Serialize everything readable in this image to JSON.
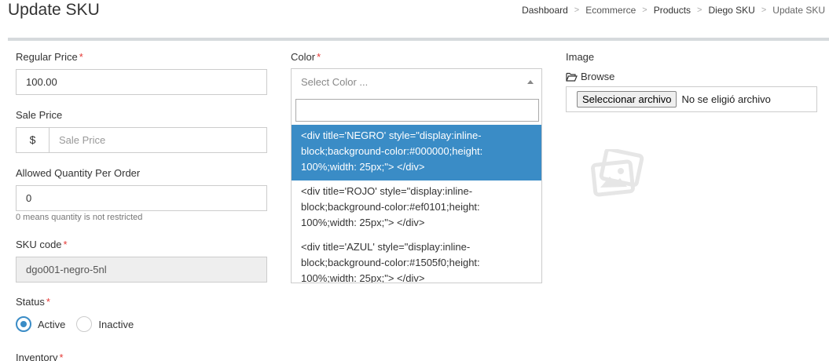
{
  "header": {
    "title": "Update SKU"
  },
  "breadcrumb": [
    "Dashboard",
    "Ecommerce",
    "Products",
    "Diego SKU",
    "Update SKU"
  ],
  "form": {
    "regular_price": {
      "label": "Regular Price",
      "required": "*",
      "value": "100.00"
    },
    "sale_price": {
      "label": "Sale Price",
      "addon": "$",
      "placeholder": "Sale Price"
    },
    "allowed_qty": {
      "label": "Allowed Quantity Per Order",
      "value": "0",
      "help": "0 means quantity is not restricted"
    },
    "sku_code": {
      "label": "SKU code",
      "required": "*",
      "value": "dgo001-negro-5nl"
    },
    "status": {
      "label": "Status",
      "required": "*",
      "options": [
        "Active",
        "Inactive"
      ],
      "selected": "Active"
    },
    "inventory": {
      "label": "Inventory",
      "required": "*"
    },
    "color": {
      "label": "Color",
      "required": "*",
      "placeholder": "Select Color ...",
      "options": [
        "<div title='NEGRO' style=\"display:inline-block;background-color:#000000;height: 100%;width: 25px;\"> </div>",
        "<div title='ROJO' style=\"display:inline-block;background-color:#ef0101;height: 100%;width: 25px;\"> </div>",
        "<div title='AZUL' style=\"display:inline-block;background-color:#1505f0;height: 100%;width: 25px;\"> </div>"
      ]
    },
    "image": {
      "label": "Image",
      "browse": "Browse",
      "file_button": "Seleccionar archivo",
      "file_status": "No se eligió archivo"
    }
  },
  "colors": {
    "accent": "#3a8cc6",
    "required": "#e53935",
    "divider": "#d6dadd"
  }
}
